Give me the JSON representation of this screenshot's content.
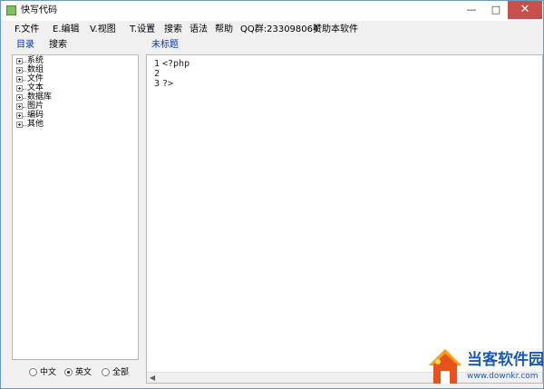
{
  "window": {
    "title": "快写代码",
    "minimize": "—",
    "maximize": "□",
    "close": "✕"
  },
  "menu": [
    {
      "label": "F.文件"
    },
    {
      "label": "E.编辑"
    },
    {
      "label": "V.视图"
    },
    {
      "label": "T.设置"
    },
    {
      "label": "搜索"
    },
    {
      "label": "语法"
    },
    {
      "label": "帮助"
    },
    {
      "label": "QQ群:233098064"
    },
    {
      "label": "赞助本软件"
    }
  ],
  "sidebar": {
    "tabs": [
      {
        "label": "目录"
      },
      {
        "label": "搜索"
      }
    ],
    "tree": [
      {
        "label": "系统"
      },
      {
        "label": "数组"
      },
      {
        "label": "文件"
      },
      {
        "label": "文本"
      },
      {
        "label": "数据库"
      },
      {
        "label": "图片"
      },
      {
        "label": "编码"
      },
      {
        "label": "其他"
      }
    ],
    "language_options": [
      {
        "label": "中文",
        "checked": false
      },
      {
        "label": "英文",
        "checked": true
      },
      {
        "label": "全部",
        "checked": false
      }
    ]
  },
  "editor": {
    "tab_title": "未标题",
    "lines": [
      {
        "num": "1",
        "text": "<?php"
      },
      {
        "num": "2",
        "text": ""
      },
      {
        "num": "3",
        "text": "?>"
      }
    ]
  },
  "watermark": {
    "title": "当客软件园",
    "url": "www.downkr.com"
  },
  "colors": {
    "accent_tab": "#0033cc",
    "close_button": "#c7504d",
    "watermark": "#1a5ab5"
  },
  "icons": {
    "app": "app-icon",
    "expander": "plus-box-icon",
    "scroll_left": "chevron-left-icon"
  }
}
